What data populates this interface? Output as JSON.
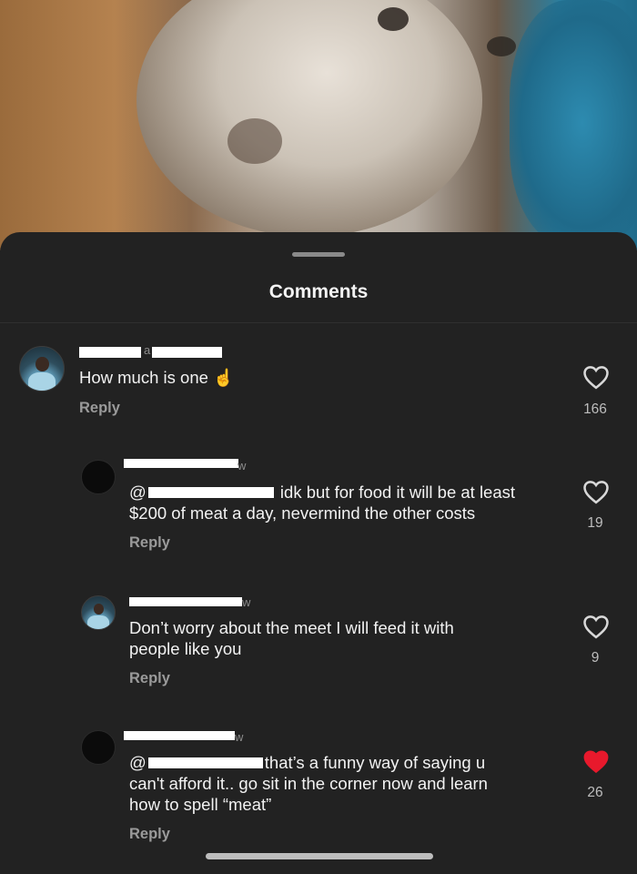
{
  "sheet": {
    "title": "Comments"
  },
  "comments": [
    {
      "text": "How much is one ☝️",
      "reply_label": "Reply",
      "likes": "166",
      "liked": false,
      "time": "a"
    },
    {
      "text_after_mention": " idk but for food it will be at least",
      "text_line2": "$200 of meat a day, nevermind the other costs",
      "prefix": "@",
      "reply_label": "Reply",
      "likes": "19",
      "liked": false,
      "time": "w"
    },
    {
      "text_line1": "Don’t worry about the meet I will feed it with",
      "text_line2": "people like you",
      "reply_label": "Reply",
      "likes": "9",
      "liked": false,
      "time": "w"
    },
    {
      "prefix": "@",
      "text_after_mention": "that’s a funny way of saying u",
      "text_line2": "can't afford it.. go sit in the corner now and learn",
      "text_line3": "how to spell “meat”",
      "reply_label": "Reply",
      "likes": "26",
      "liked": true,
      "time": "w"
    }
  ],
  "colors": {
    "liked_heart": "#e8192c",
    "background": "#222222"
  }
}
